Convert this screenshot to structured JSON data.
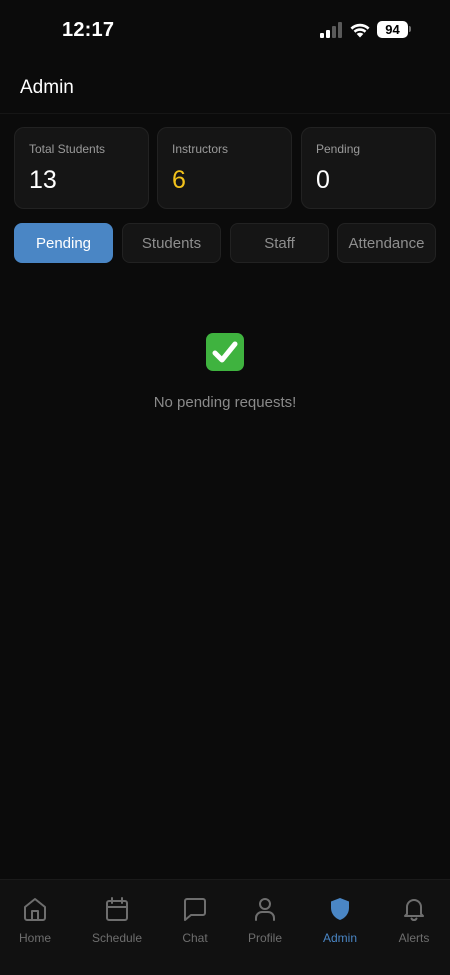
{
  "status_bar": {
    "time": "12:17",
    "battery": "94",
    "icons": [
      "cellular-signal-icon",
      "wifi-icon",
      "battery-icon"
    ]
  },
  "header": {
    "title": "Admin"
  },
  "stats": [
    {
      "label": "Total Students",
      "value": "13"
    },
    {
      "label": "Instructors",
      "value": "6",
      "color": "#f2c21b"
    },
    {
      "label": "Pending",
      "value": "0"
    }
  ],
  "tabs": [
    {
      "label": "Pending",
      "active": true
    },
    {
      "label": "Students",
      "active": false
    },
    {
      "label": "Staff",
      "active": false
    },
    {
      "label": "Attendance",
      "active": false
    }
  ],
  "empty_state": {
    "icon": "check-mark-icon",
    "message": "No pending requests!"
  },
  "bottom_nav": [
    {
      "label": "Home",
      "icon": "home-icon"
    },
    {
      "label": "Schedule",
      "icon": "calendar-icon"
    },
    {
      "label": "Chat",
      "icon": "chat-bubble-icon"
    },
    {
      "label": "Profile",
      "icon": "user-icon"
    },
    {
      "label": "Admin",
      "icon": "shield-icon",
      "active": true
    },
    {
      "label": "Alerts",
      "icon": "bell-icon"
    }
  ],
  "colors": {
    "accent": "#4a86c5",
    "highlight": "#f2c21b",
    "background": "#0b0b0b",
    "card": "#151515",
    "success": "#3fb33f"
  }
}
